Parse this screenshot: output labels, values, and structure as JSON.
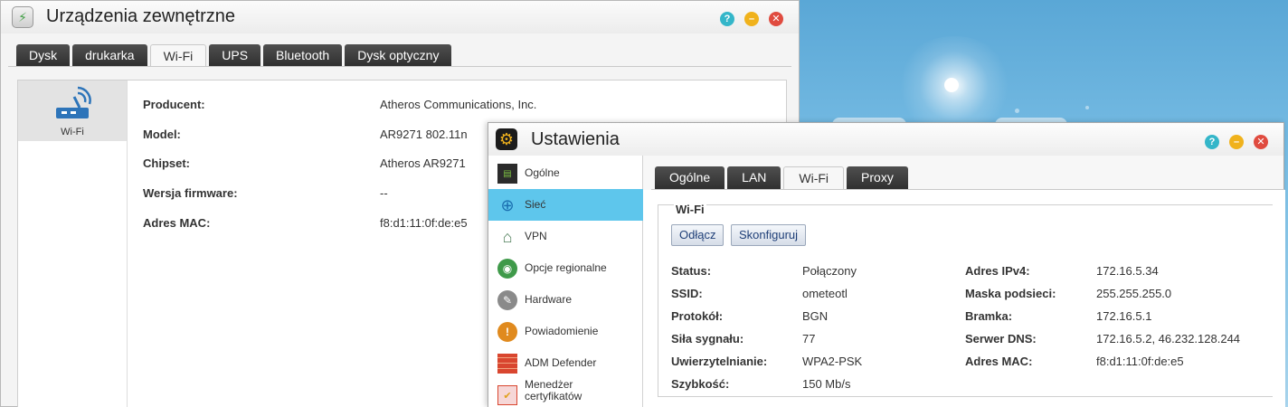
{
  "desktop": {},
  "devices_window": {
    "title": "Urządzenia zewnętrzne",
    "tabs": [
      "Dysk",
      "drukarka",
      "Wi-Fi",
      "UPS",
      "Bluetooth",
      "Dysk optyczny"
    ],
    "active_tab": "Wi-Fi",
    "device_list": [
      {
        "label": "Wi-Fi",
        "icon": "wifi-router-icon"
      }
    ],
    "details": [
      {
        "key": "Producent:",
        "value": "Atheros Communications, Inc."
      },
      {
        "key": "Model:",
        "value": "AR9271 802.11n"
      },
      {
        "key": "Chipset:",
        "value": "Atheros AR9271"
      },
      {
        "key": "Wersja firmware:",
        "value": "--"
      },
      {
        "key": "Adres MAC:",
        "value": "f8:d1:11:0f:de:e5"
      }
    ],
    "controls": {
      "help": "?",
      "minimize": "–",
      "close": "✕"
    }
  },
  "settings_window": {
    "title": "Ustawienia",
    "controls": {
      "help": "?",
      "minimize": "–",
      "close": "✕"
    },
    "sidebar": [
      {
        "label": "Ogólne",
        "icon": "server-icon"
      },
      {
        "label": "Sieć",
        "icon": "globe-icon",
        "active": true
      },
      {
        "label": "VPN",
        "icon": "vpn-house-icon"
      },
      {
        "label": "Opcje regionalne",
        "icon": "globe-region-icon"
      },
      {
        "label": "Hardware",
        "icon": "hardware-icon"
      },
      {
        "label": "Powiadomienie",
        "icon": "notification-icon"
      },
      {
        "label": "ADM Defender",
        "icon": "firewall-icon"
      },
      {
        "label": "Menedżer certyfikatów",
        "icon": "certificate-icon"
      }
    ],
    "tabs": [
      "Ogólne",
      "LAN",
      "Wi-Fi",
      "Proxy"
    ],
    "active_tab": "Wi-Fi",
    "group_title": "Wi-Fi",
    "buttons": {
      "disconnect": "Odłącz",
      "configure": "Skonfiguruj"
    },
    "left_fields": [
      {
        "key": "Status:",
        "value": "Połączony"
      },
      {
        "key": "SSID:",
        "value": "ometeotl"
      },
      {
        "key": "Protokół:",
        "value": "BGN"
      },
      {
        "key": "Siła sygnału:",
        "value": "77"
      },
      {
        "key": "Uwierzytelnianie:",
        "value": "WPA2-PSK"
      },
      {
        "key": "Szybkość:",
        "value": "150 Mb/s"
      }
    ],
    "right_fields": [
      {
        "key": "Adres IPv4:",
        "value": "172.16.5.34"
      },
      {
        "key": "Maska podsieci:",
        "value": "255.255.255.0"
      },
      {
        "key": "Bramka:",
        "value": "172.16.5.1"
      },
      {
        "key": "Serwer DNS:",
        "value": "172.16.5.2, 46.232.128.244"
      },
      {
        "key": "Adres MAC:",
        "value": "f8:d1:11:0f:de:e5"
      }
    ]
  }
}
